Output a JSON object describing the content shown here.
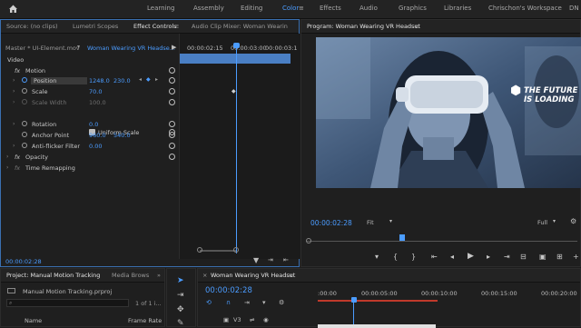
{
  "topbar": {
    "workspaces": [
      "Learning",
      "Assembly",
      "Editing",
      "Color",
      "Effects",
      "Audio",
      "Graphics",
      "Libraries",
      "Chrischon's Workspace",
      "DN"
    ],
    "active": "Color",
    "more": "»"
  },
  "effect_panel": {
    "tabs": [
      "Source: (no clips)",
      "Lumetri Scopes",
      "Effect Controls",
      "Audio Clip Mixer: Woman Wearin"
    ],
    "more": "≡",
    "master": "Master * UI-Element.mov",
    "clip": "Woman Wearing VR Headse...",
    "ruler": [
      "00:00:02:15",
      "00:00:03:00",
      "00:00:03:1"
    ],
    "section_video": "Video",
    "fx_label": "fx",
    "motion": "Motion",
    "position_label": "Position",
    "position_x": "1248.0",
    "position_y": "230.0",
    "scale_label": "Scale",
    "scale_val": "70.0",
    "scale_width_label": "Scale Width",
    "scale_width_val": "100.0",
    "uniform_scale": "Uniform Scale",
    "rotation_label": "Rotation",
    "rotation_val": "0.0",
    "anchor_label": "Anchor Point",
    "anchor_x": "960.0",
    "anchor_y": "540.0",
    "antiflicker_label": "Anti-flicker Filter",
    "antiflicker_val": "0.00",
    "opacity": "Opacity",
    "time_remap": "Time Remapping",
    "timecode": "00:00:02:28"
  },
  "program_monitor": {
    "title": "Program: Woman Wearing VR Headset",
    "more": "≡",
    "overlay_line1": "THE FUTURE",
    "overlay_line2": "IS LOADING",
    "timecode": "00:00:02:28",
    "fit": "Fit",
    "quality": "Full"
  },
  "project_panel": {
    "tabs": [
      "Project: Manual Motion Tracking",
      "Media Brows"
    ],
    "more": "»",
    "file": "Manual Motion Tracking.prproj",
    "count": "1 of 1 i...",
    "col_name": "Name",
    "col_rate": "Frame Rate"
  },
  "timeline": {
    "title": "Woman Wearing VR Headset",
    "more": "≡",
    "timecode": "00:00:02:28",
    "ruler": [
      ":00:00",
      "00:00:05:00",
      "00:00:10:00",
      "00:00:15:00",
      "00:00:20:00"
    ],
    "track": "V3"
  }
}
